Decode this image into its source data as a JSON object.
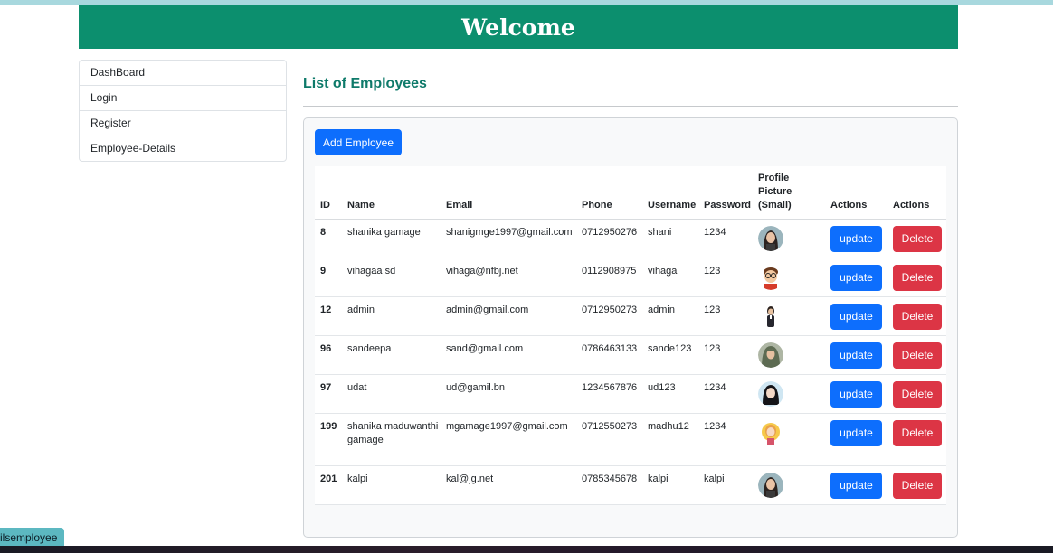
{
  "header": {
    "title": "Welcome"
  },
  "sidebar": {
    "items": [
      {
        "label": "DashBoard"
      },
      {
        "label": "Login"
      },
      {
        "label": "Register"
      },
      {
        "label": "Employee-Details"
      }
    ]
  },
  "main": {
    "title": "List of Employees",
    "add_button": "Add Employee",
    "columns": [
      "ID",
      "Name",
      "Email",
      "Phone",
      "Username",
      "Password",
      "Profile Picture (Small)",
      "Actions",
      "Actions"
    ],
    "update_label": "update",
    "delete_label": "Delete",
    "rows": [
      {
        "id": "8",
        "name": "shanika gamage",
        "email": "shanigmge1997@gmail.com",
        "phone": "0712950276",
        "username": "shani",
        "password": "1234",
        "avatar": "woman-long-hair-avatar"
      },
      {
        "id": "9",
        "name": "vihagaa sd",
        "email": "vihaga@nfbj.net",
        "phone": "0112908975",
        "username": "vihaga",
        "password": "123",
        "avatar": "boy-glasses-avatar"
      },
      {
        "id": "12",
        "name": "admin",
        "email": "admin@gmail.com",
        "phone": "0712950273",
        "username": "admin",
        "password": "123",
        "avatar": "businesswoman-avatar"
      },
      {
        "id": "96",
        "name": "sandeepa",
        "email": "sand@gmail.com",
        "phone": "0786463133",
        "username": "sande123",
        "password": "123",
        "avatar": "hijab-woman-avatar"
      },
      {
        "id": "97",
        "name": "udat",
        "email": "ud@gamil.bn",
        "phone": "1234567876",
        "username": "ud123",
        "password": "1234",
        "avatar": "girl-dark-hair-avatar"
      },
      {
        "id": "199",
        "name": "shanika maduwanthi gamage",
        "email": "mgamage1997@gmail.com",
        "phone": "0712550273",
        "username": "madhu12",
        "password": "1234",
        "avatar": "sun-girl-avatar"
      },
      {
        "id": "201",
        "name": "kalpi",
        "email": "kal@jg.net",
        "phone": "0785345678",
        "username": "kalpi",
        "password": "kalpi",
        "avatar": "woman-long-hair-avatar"
      }
    ]
  },
  "footer": {
    "tab_label": "ilsemployee"
  },
  "colors": {
    "header_bg": "#0c8f6e",
    "title": "#0e7a6a",
    "primary": "#0d6efd",
    "danger": "#dc3545"
  }
}
